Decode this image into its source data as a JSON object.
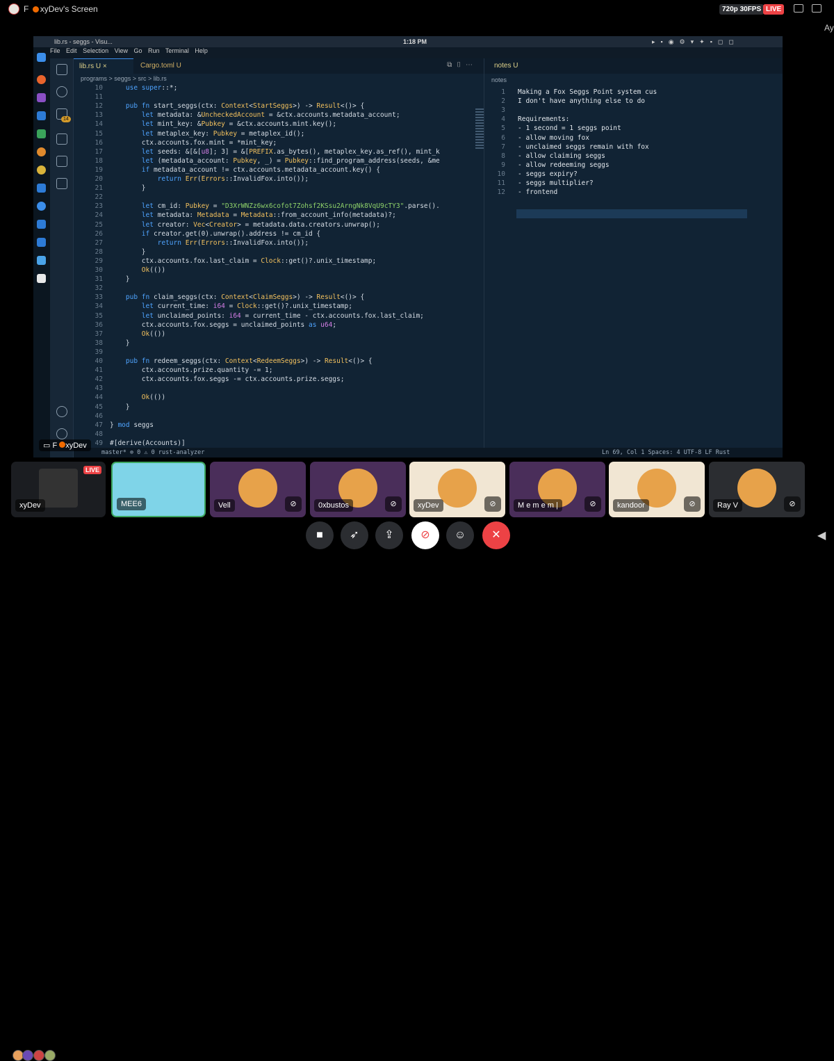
{
  "window": {
    "title": "xyDev's Screen",
    "title_prefix": "F",
    "resolution": "720p 30FPS",
    "live": "LIVE",
    "user_initial": "Ay"
  },
  "screen": {
    "tab_title": "lib.rs - seggs - Visu...",
    "clock": "1:18 PM",
    "menu": [
      "File",
      "Edit",
      "Selection",
      "View",
      "Go",
      "Run",
      "Terminal",
      "Help"
    ],
    "badge": "14",
    "editor_tabs": [
      "lib.rs U",
      "Cargo.toml U"
    ],
    "breadcrumb": "programs > seggs > src > lib.rs",
    "code_lines": [
      {
        "n": "10",
        "t": "    use super::*;"
      },
      {
        "n": "11",
        "t": ""
      },
      {
        "n": "12",
        "t": "    pub fn start_seggs(ctx: Context<StartSeggs>) -> Result<()> {"
      },
      {
        "n": "13",
        "t": "        let metadata: &UncheckedAccount = &ctx.accounts.metadata_account;"
      },
      {
        "n": "14",
        "t": "        let mint_key: &Pubkey = &ctx.accounts.mint.key();"
      },
      {
        "n": "15",
        "t": "        let metaplex_key: Pubkey = metaplex_id();"
      },
      {
        "n": "16",
        "t": "        ctx.accounts.fox.mint = *mint_key;"
      },
      {
        "n": "17",
        "t": "        let seeds: &[&[u8]; 3] = &[PREFIX.as_bytes(), metaplex_key.as_ref(), mint_k"
      },
      {
        "n": "18",
        "t": "        let (metadata_account: Pubkey, _) = Pubkey::find_program_address(seeds, &me"
      },
      {
        "n": "19",
        "t": "        if metadata_account != ctx.accounts.metadata_account.key() {"
      },
      {
        "n": "20",
        "t": "            return Err(Errors::InvalidFox.into());"
      },
      {
        "n": "21",
        "t": "        }"
      },
      {
        "n": "22",
        "t": ""
      },
      {
        "n": "23",
        "t": "        let cm_id: Pubkey = \"D3XrWNZz6wx6cofot7Zohsf2KSsu2ArngNk8VqU9cTY3\".parse()."
      },
      {
        "n": "24",
        "t": "        let metadata: Metadata = Metadata::from_account_info(metadata)?;"
      },
      {
        "n": "25",
        "t": "        let creator: Vec<Creator> = metadata.data.creators.unwrap();"
      },
      {
        "n": "26",
        "t": "        if creator.get(0).unwrap().address != cm_id {"
      },
      {
        "n": "27",
        "t": "            return Err(Errors::InvalidFox.into());"
      },
      {
        "n": "28",
        "t": "        }"
      },
      {
        "n": "29",
        "t": "        ctx.accounts.fox.last_claim = Clock::get()?.unix_timestamp;"
      },
      {
        "n": "30",
        "t": "        Ok(())"
      },
      {
        "n": "31",
        "t": "    }"
      },
      {
        "n": "32",
        "t": ""
      },
      {
        "n": "33",
        "t": "    pub fn claim_seggs(ctx: Context<ClaimSeggs>) -> Result<()> {"
      },
      {
        "n": "34",
        "t": "        let current_time: i64 = Clock::get()?.unix_timestamp;"
      },
      {
        "n": "35",
        "t": "        let unclaimed_points: i64 = current_time - ctx.accounts.fox.last_claim;"
      },
      {
        "n": "36",
        "t": "        ctx.accounts.fox.seggs = unclaimed_points as u64;"
      },
      {
        "n": "37",
        "t": "        Ok(())"
      },
      {
        "n": "38",
        "t": "    }"
      },
      {
        "n": "39",
        "t": ""
      },
      {
        "n": "40",
        "t": "    pub fn redeem_seggs(ctx: Context<RedeemSeggs>) -> Result<()> {"
      },
      {
        "n": "41",
        "t": "        ctx.accounts.prize.quantity -= 1;"
      },
      {
        "n": "42",
        "t": "        ctx.accounts.fox.seggs -= ctx.accounts.prize.seggs;"
      },
      {
        "n": "43",
        "t": ""
      },
      {
        "n": "44",
        "t": "        Ok(())"
      },
      {
        "n": "45",
        "t": "    }"
      },
      {
        "n": "46",
        "t": ""
      },
      {
        "n": "47",
        "t": "} mod seggs"
      },
      {
        "n": "48",
        "t": ""
      },
      {
        "n": "49",
        "t": "#[derive(Accounts)]"
      }
    ],
    "notes_tab": "notes U",
    "notes_crumb": "notes",
    "notes_lines": [
      {
        "n": "1",
        "t": "Making a Fox Seggs Point system cus"
      },
      {
        "n": "2",
        "t": "I don't have anything else to do"
      },
      {
        "n": "3",
        "t": ""
      },
      {
        "n": "4",
        "t": "Requirements:"
      },
      {
        "n": "5",
        "t": "- 1 second = 1 seggs point"
      },
      {
        "n": "6",
        "t": "- allow moving fox"
      },
      {
        "n": "7",
        "t": "- unclaimed seggs remain with fox"
      },
      {
        "n": "8",
        "t": "- allow claiming seggs"
      },
      {
        "n": "9",
        "t": "- allow redeeming seggs"
      },
      {
        "n": "10",
        "t": "- seggs expiry?"
      },
      {
        "n": "11",
        "t": "- seggs multiplier?"
      },
      {
        "n": "12",
        "t": "- frontend"
      }
    ],
    "status_left": "master*   ⊗ 0  ⚠ 0   rust-analyzer",
    "status_right": "Ln 69, Col 1   Spaces: 4   UTF-8   LF   Rust",
    "share_label": "xyDev"
  },
  "participants": [
    {
      "name": "xyDev",
      "live": "LIVE",
      "color": "#1b1d21"
    },
    {
      "name": "MEE6",
      "color": "#7fd4e8"
    },
    {
      "name": "Vell",
      "color": "#4a2e5a"
    },
    {
      "name": "0xbustos",
      "color": "#4a2e5a"
    },
    {
      "name": "xyDev",
      "color": "#f1e6d3"
    },
    {
      "name": "M e m e m |",
      "color": "#4a2e5a"
    },
    {
      "name": "kandoor",
      "color": "#f1e6d3"
    },
    {
      "name": "Ray V",
      "color": "#2b2d31"
    }
  ],
  "colors": {
    "accent": "#3b8eea",
    "live": "#ed4245",
    "hangup": "#ed4245",
    "fox": "#f06a00"
  }
}
